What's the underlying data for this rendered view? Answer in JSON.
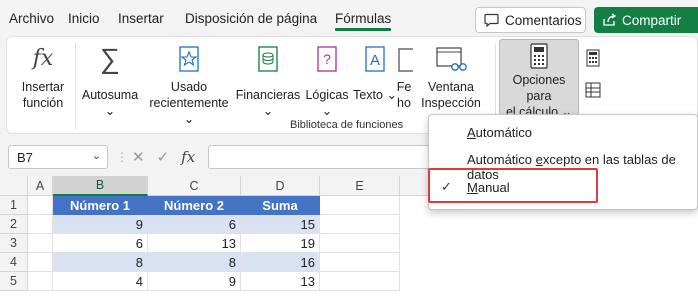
{
  "menubar": {
    "tabs": [
      {
        "label": "Archivo"
      },
      {
        "label": "Inicio"
      },
      {
        "label": "Insertar"
      },
      {
        "label": "Disposición de página"
      },
      {
        "label": "Fórmulas"
      }
    ],
    "comments_label": "Comentarios",
    "share_label": "Compartir"
  },
  "ribbon": {
    "insert_function": {
      "line1": "Insertar",
      "line2": "función"
    },
    "autosum": {
      "label": "Autosuma",
      "chevron": "⌄"
    },
    "recent": {
      "line1": "Usado",
      "line2": "recientemente",
      "chevron": "⌄"
    },
    "financial": {
      "label": "Financieras",
      "chevron": "⌄"
    },
    "logical": {
      "label": "Lógicas",
      "chevron": "⌄"
    },
    "text": {
      "label": "Texto",
      "chevron": "⌄"
    },
    "date": {
      "line1": "Fe",
      "line2": "ho"
    },
    "watch": {
      "line1": "Ventana",
      "line2": "Inspección"
    },
    "calc_options": {
      "line1": "Opciones para",
      "line2": "el cálculo",
      "chevron": "⌄"
    },
    "group_label": "Biblioteca de funciones"
  },
  "formula_bar": {
    "name_box": "B7",
    "cancel": "✕",
    "enter": "✓",
    "fx": "fx"
  },
  "grid": {
    "columns": [
      "A",
      "B",
      "C",
      "D",
      "E"
    ],
    "rows": [
      "1",
      "2",
      "3",
      "4",
      "5"
    ],
    "table_headers": [
      "Número 1",
      "Número 2",
      "Suma"
    ],
    "table_rows": [
      [
        "9",
        "6",
        "15"
      ],
      [
        "6",
        "13",
        "19"
      ],
      [
        "8",
        "8",
        "16"
      ],
      [
        "4",
        "9",
        "13"
      ]
    ]
  },
  "dropdown": {
    "items": [
      {
        "pre": "",
        "acc": "A",
        "post": "utomático"
      },
      {
        "pre": "Automático ",
        "acc": "e",
        "post": "xcepto en las tablas de datos"
      },
      {
        "pre": "",
        "acc": "M",
        "post": "anual"
      }
    ],
    "checkmark": "✓"
  },
  "colors": {
    "accent": "#107c41",
    "table_header": "#4472c4",
    "table_band": "#d9e1f2",
    "highlight": "#e0393e"
  }
}
